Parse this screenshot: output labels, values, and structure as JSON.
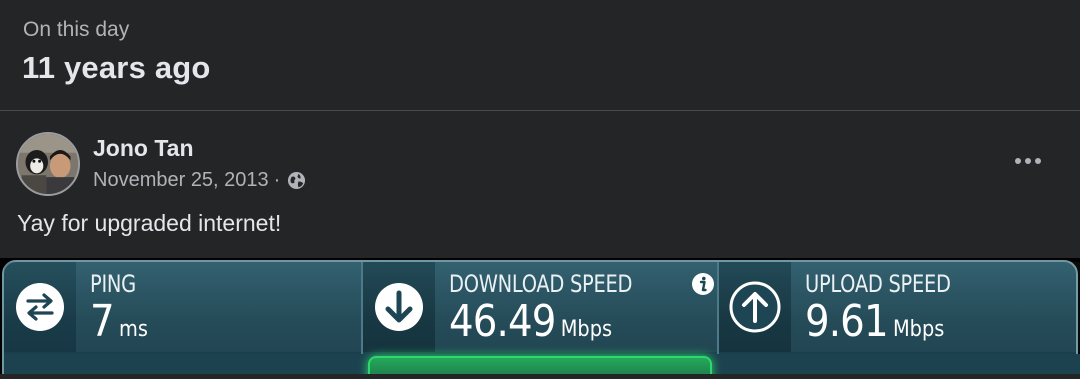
{
  "memory": {
    "kicker": "On this day",
    "title": "11 years ago"
  },
  "post": {
    "author": "Jono Tan",
    "date": "November 25, 2013",
    "separator": "·",
    "privacy_icon": "globe-icon",
    "more_icon": "more-horizontal-icon",
    "text": "Yay for upgraded internet!"
  },
  "speedtest": {
    "ping": {
      "label": "PING",
      "value": "7",
      "unit": "ms",
      "icon": "arrows-exchange-icon"
    },
    "download": {
      "label": "DOWNLOAD SPEED",
      "value": "46.49",
      "unit": "Mbps",
      "icon": "download-arrow-icon",
      "info_icon": "info-icon"
    },
    "upload": {
      "label": "UPLOAD SPEED",
      "value": "9.61",
      "unit": "Mbps",
      "icon": "upload-arrow-icon"
    }
  },
  "colors": {
    "background": "#242526",
    "text_primary": "#e4e6eb",
    "text_secondary": "#b0b3b8",
    "panel_teal": "#1e4553",
    "accent_green": "#2cd96b"
  }
}
